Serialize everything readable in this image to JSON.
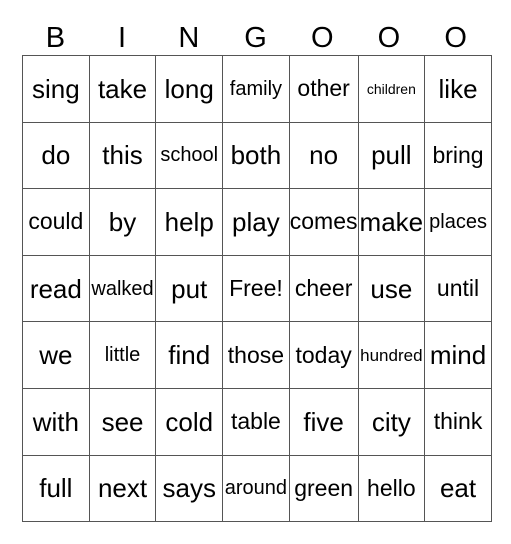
{
  "header": [
    "B",
    "I",
    "N",
    "G",
    "O",
    "O",
    "O"
  ],
  "grid": [
    [
      "sing",
      "take",
      "long",
      "family",
      "other",
      "children",
      "like"
    ],
    [
      "do",
      "this",
      "school",
      "both",
      "no",
      "pull",
      "bring"
    ],
    [
      "could",
      "by",
      "help",
      "play",
      "comes",
      "make",
      "places"
    ],
    [
      "read",
      "walked",
      "put",
      "Free!",
      "cheer",
      "use",
      "until"
    ],
    [
      "we",
      "little",
      "find",
      "those",
      "today",
      "hundred",
      "mind"
    ],
    [
      "with",
      "see",
      "cold",
      "table",
      "five",
      "city",
      "think"
    ],
    [
      "full",
      "next",
      "says",
      "around",
      "green",
      "hello",
      "eat"
    ]
  ]
}
